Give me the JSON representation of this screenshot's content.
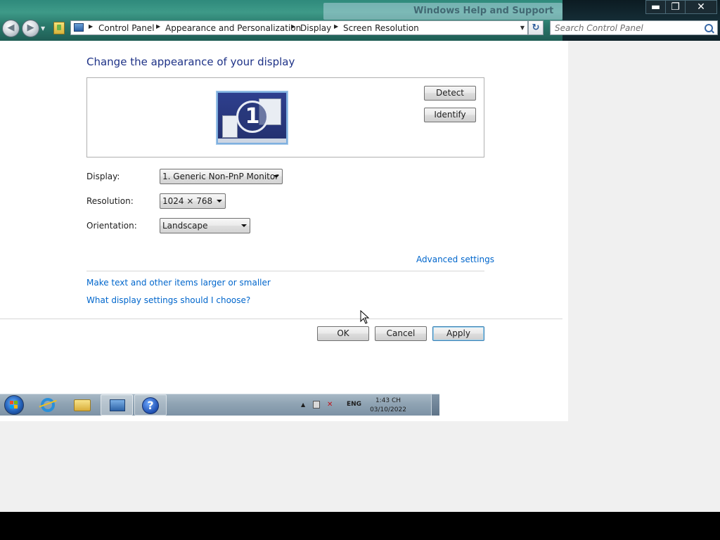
{
  "window": {
    "ghost_title": "Windows Help and Support",
    "controls": {
      "minimize": "▬",
      "maximize": "❐",
      "close": "✕"
    }
  },
  "navigation": {
    "back_icon": "back-arrow-icon",
    "forward_icon": "forward-arrow-icon",
    "breadcrumbs": [
      "Control Panel",
      "Appearance and Personalization",
      "Display",
      "Screen Resolution"
    ],
    "refresh_icon": "refresh-icon",
    "search_placeholder": "Search Control Panel"
  },
  "page": {
    "title": "Change the appearance of your display",
    "monitor_number": "1",
    "detect_label": "Detect",
    "identify_label": "Identify",
    "display_label": "Display:",
    "display_value": "1. Generic Non-PnP Monitor",
    "resolution_label": "Resolution:",
    "resolution_value": "1024 × 768",
    "orientation_label": "Orientation:",
    "orientation_value": "Landscape",
    "advanced_link": "Advanced settings",
    "text_size_link": "Make text and other items larger or smaller",
    "which_settings_link": "What display settings should I choose?",
    "ok_label": "OK",
    "cancel_label": "Cancel",
    "apply_label": "Apply"
  },
  "taskbar": {
    "pinned": [
      "start-orb-icon",
      "internet-explorer-icon",
      "windows-explorer-icon",
      "control-panel-icon",
      "help-and-support-icon"
    ],
    "help_glyph": "?",
    "tray_arrow": "▲",
    "language": "ENG",
    "time": "1:43 CH",
    "date": "03/10/2022"
  },
  "colors": {
    "title_text": "#1e3287",
    "link": "#0066cc",
    "titlebar": "#2f8a7c",
    "taskbar": "#8fa3b3",
    "apply_border": "#3c7fb1"
  }
}
